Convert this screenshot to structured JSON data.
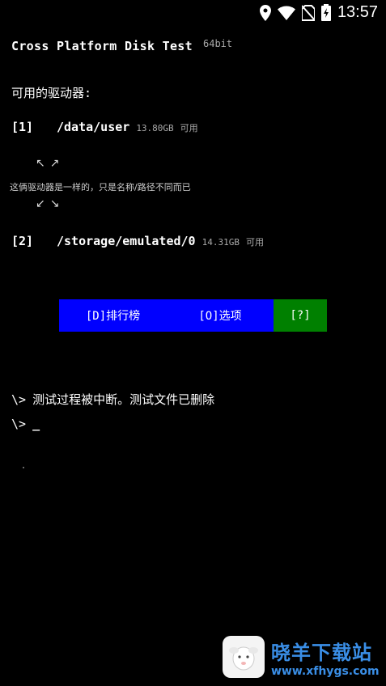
{
  "status_bar": {
    "time": "13:57",
    "icons": [
      "location-icon",
      "wifi-icon",
      "no-sim-icon",
      "battery-charging-icon"
    ]
  },
  "header": {
    "title": "Cross Platform Disk Test",
    "arch": "64bit"
  },
  "drives": {
    "label": "可用的驱动器:",
    "items": [
      {
        "index": "[1]",
        "path": "/data/user",
        "size": "13.80GB",
        "available": "可用"
      },
      {
        "index": "[2]",
        "path": "/storage/emulated/0",
        "size": "14.31GB",
        "available": "可用"
      }
    ],
    "arrows_up": "↖↗",
    "arrows_down": "↙↘",
    "same_drive_note": "这俩驱动器是一样的，只是名称/路径不同而已"
  },
  "buttons": {
    "ranking": "[D]排行榜",
    "options": "[O]选项",
    "help": "[?]"
  },
  "console": {
    "prompt": "\\>",
    "message": "测试过程被中断。测试文件已删除",
    "cursor": "_"
  },
  "watermark": {
    "name": "晓羊下载站",
    "url": "www.xfhygs.com"
  },
  "colors": {
    "background": "#000000",
    "button_blue": "#0000ff",
    "button_green": "#008000",
    "watermark_blue": "#3a8ee6"
  }
}
